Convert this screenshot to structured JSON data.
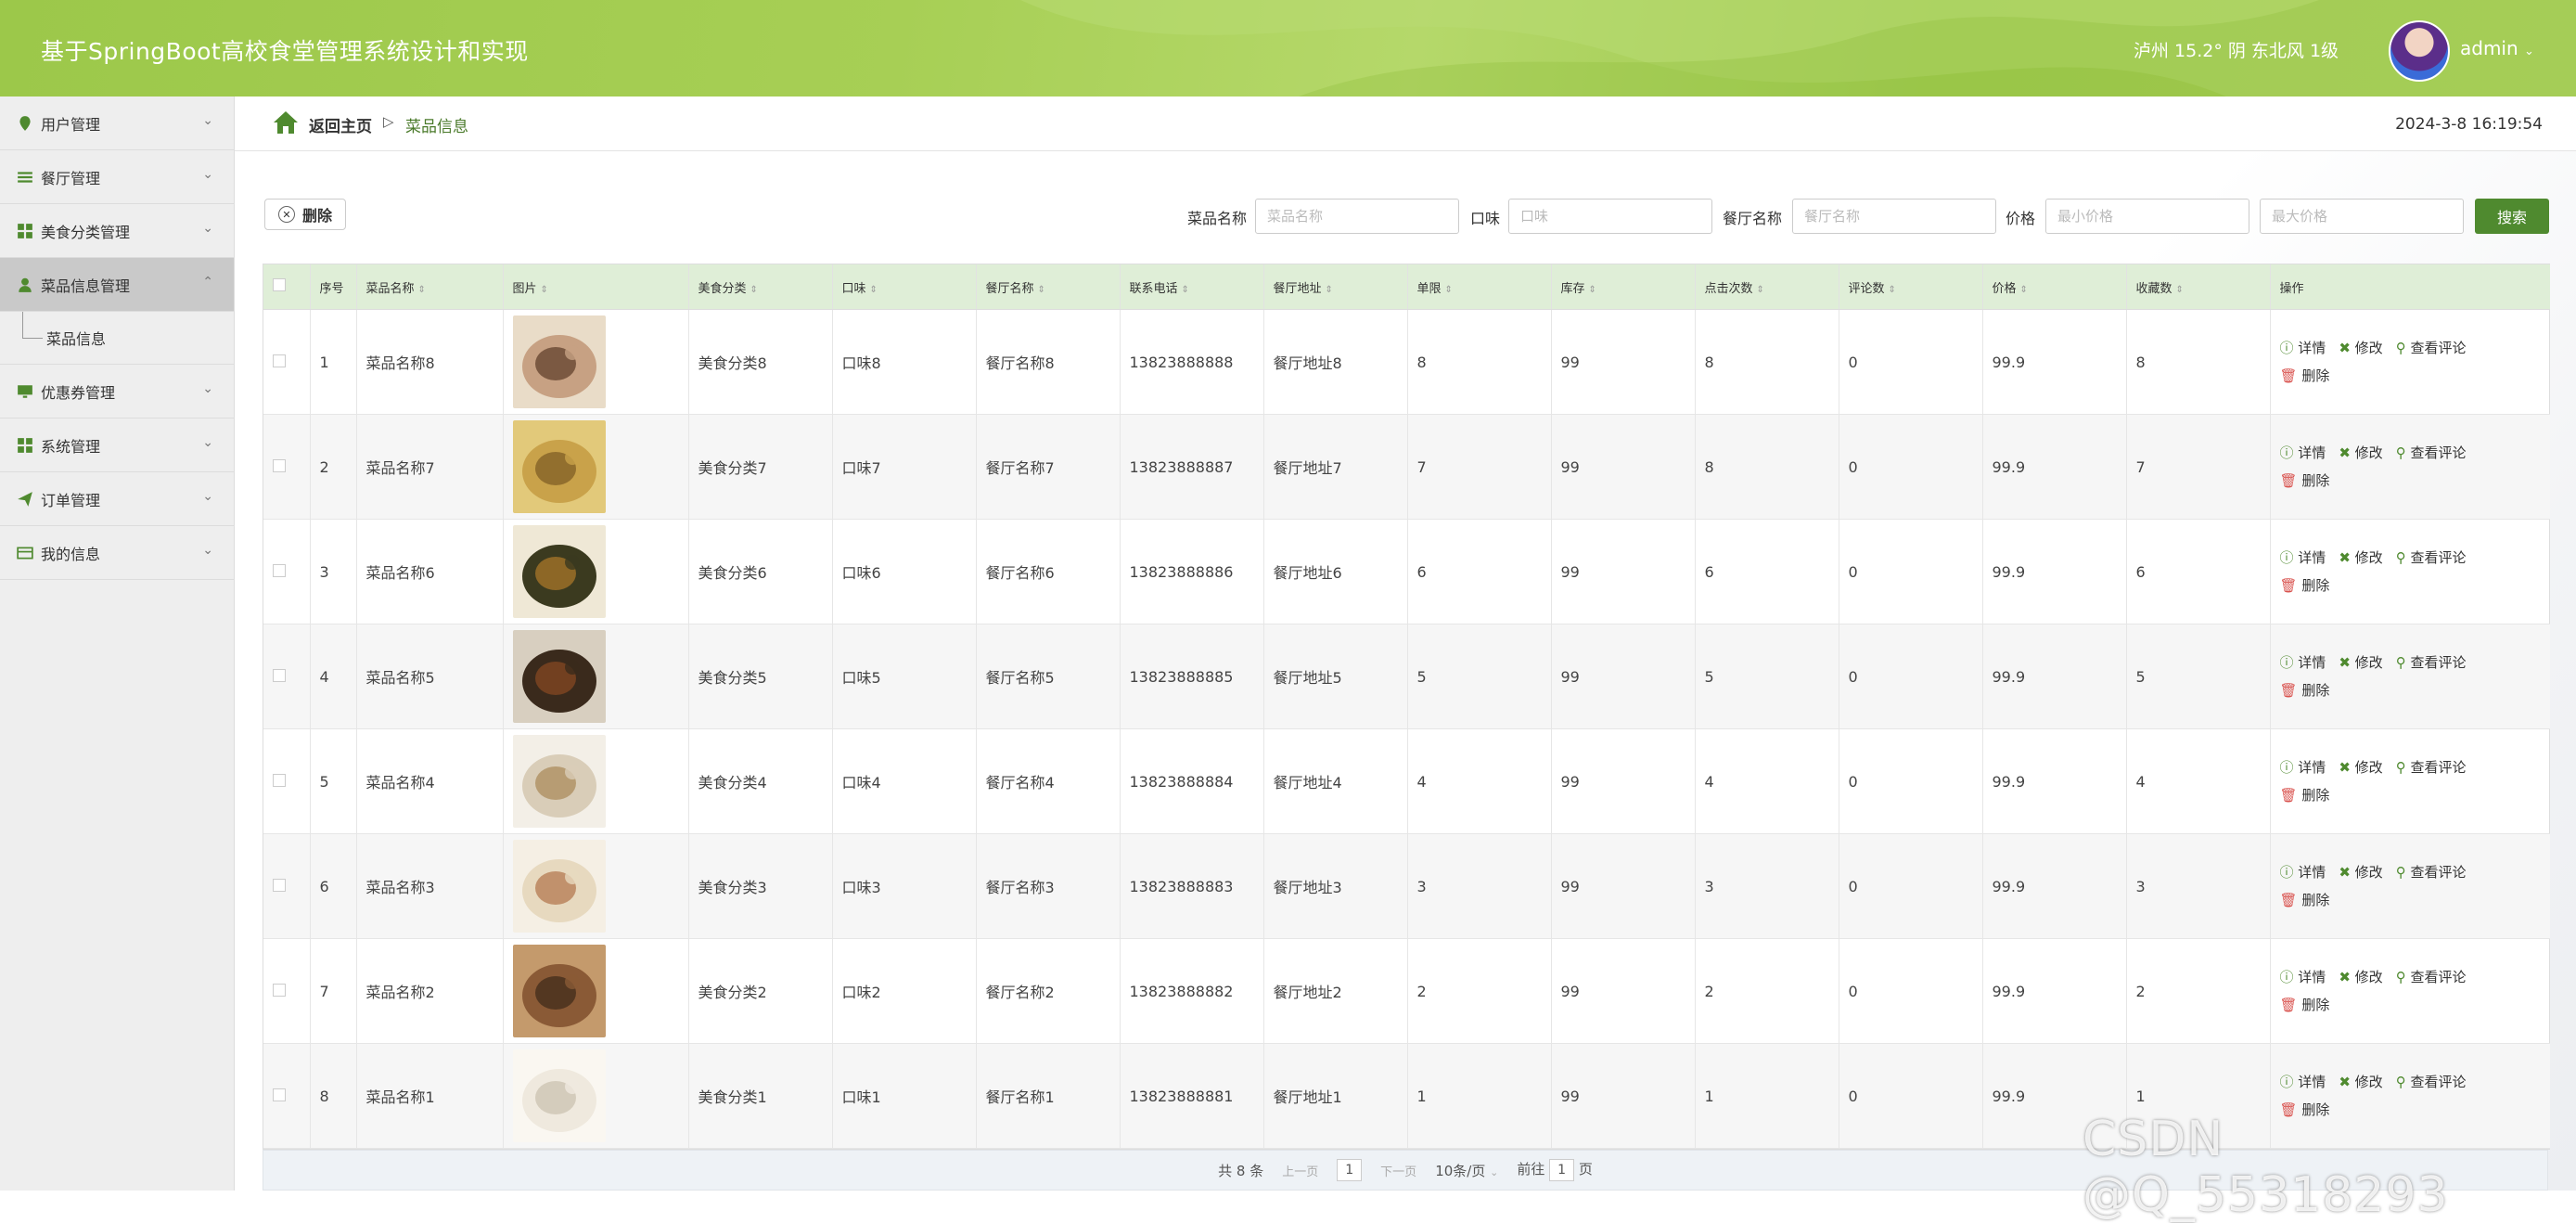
{
  "header": {
    "title": "基于SpringBoot高校食堂管理系统设计和实现",
    "weather": "泸州 15.2° 阴 东北风 1级",
    "username": "admin"
  },
  "sidebar": {
    "items": [
      {
        "label": "用户管理",
        "icon": "location-pin-icon"
      },
      {
        "label": "餐厅管理",
        "icon": "list-icon"
      },
      {
        "label": "美食分类管理",
        "icon": "grid-icon"
      },
      {
        "label": "菜品信息管理",
        "icon": "user-icon",
        "active": true
      },
      {
        "label": "优惠券管理",
        "icon": "monitor-icon"
      },
      {
        "label": "系统管理",
        "icon": "grid-icon"
      },
      {
        "label": "订单管理",
        "icon": "send-icon"
      },
      {
        "label": "我的信息",
        "icon": "card-icon"
      }
    ],
    "sub_item": "菜品信息"
  },
  "breadcrumb": {
    "home": "返回主页",
    "separator": "▷",
    "current": "菜品信息"
  },
  "datetime": "2024-3-8 16:19:54",
  "toolbar": {
    "delete_label": "删除"
  },
  "search": {
    "name_label": "菜品名称",
    "name_placeholder": "菜品名称",
    "taste_label": "口味",
    "taste_placeholder": "口味",
    "restaurant_label": "餐厅名称",
    "restaurant_placeholder": "餐厅名称",
    "price_label": "价格",
    "min_price_placeholder": "最小价格",
    "max_price_placeholder": "最大价格",
    "search_button": "搜索"
  },
  "table": {
    "headers": [
      "序号",
      "菜品名称",
      "图片",
      "美食分类",
      "口味",
      "餐厅名称",
      "联系电话",
      "餐厅地址",
      "单限",
      "库存",
      "点击次数",
      "评论数",
      "价格",
      "收藏数",
      "操作"
    ],
    "ops": {
      "detail": "详情",
      "edit": "修改",
      "comments": "查看评论",
      "delete": "删除"
    },
    "rows": [
      {
        "no": "1",
        "name": "菜品名称8",
        "category": "美食分类8",
        "taste": "口味8",
        "restaurant": "餐厅名称8",
        "phone": "13823888888",
        "address": "餐厅地址8",
        "limit": "8",
        "stock": "99",
        "clicks": "8",
        "comments": "0",
        "price": "99.9",
        "favorites": "8",
        "image": "drink-and-cake"
      },
      {
        "no": "2",
        "name": "菜品名称7",
        "category": "美食分类7",
        "taste": "口味7",
        "restaurant": "餐厅名称7",
        "phone": "13823888887",
        "address": "餐厅地址7",
        "limit": "7",
        "stock": "99",
        "clicks": "8",
        "comments": "0",
        "price": "99.9",
        "favorites": "7",
        "image": "egg-rolls"
      },
      {
        "no": "3",
        "name": "菜品名称6",
        "category": "美食分类6",
        "taste": "口味6",
        "restaurant": "餐厅名称6",
        "phone": "13823888886",
        "address": "餐厅地址6",
        "limit": "6",
        "stock": "99",
        "clicks": "6",
        "comments": "0",
        "price": "99.9",
        "favorites": "6",
        "image": "stir-fry-plate"
      },
      {
        "no": "4",
        "name": "菜品名称5",
        "category": "美食分类5",
        "taste": "口味5",
        "restaurant": "餐厅名称5",
        "phone": "13823888885",
        "address": "餐厅地址5",
        "limit": "5",
        "stock": "99",
        "clicks": "5",
        "comments": "0",
        "price": "99.9",
        "favorites": "5",
        "image": "spicy-dish"
      },
      {
        "no": "5",
        "name": "菜品名称4",
        "category": "美食分类4",
        "taste": "口味4",
        "restaurant": "餐厅名称4",
        "phone": "13823888884",
        "address": "餐厅地址4",
        "limit": "4",
        "stock": "99",
        "clicks": "4",
        "comments": "0",
        "price": "99.9",
        "favorites": "4",
        "image": "pastry-plate"
      },
      {
        "no": "6",
        "name": "菜品名称3",
        "category": "美食分类3",
        "taste": "口味3",
        "restaurant": "餐厅名称3",
        "phone": "13823888883",
        "address": "餐厅地址3",
        "limit": "3",
        "stock": "99",
        "clicks": "3",
        "comments": "0",
        "price": "99.9",
        "favorites": "3",
        "image": "milk-tea"
      },
      {
        "no": "7",
        "name": "菜品名称2",
        "category": "美食分类2",
        "taste": "口味2",
        "restaurant": "餐厅名称2",
        "phone": "13823888882",
        "address": "餐厅地址2",
        "limit": "2",
        "stock": "99",
        "clicks": "2",
        "comments": "0",
        "price": "99.9",
        "favorites": "2",
        "image": "skewers"
      },
      {
        "no": "8",
        "name": "菜品名称1",
        "category": "美食分类1",
        "taste": "口味1",
        "restaurant": "餐厅名称1",
        "phone": "13823888881",
        "address": "餐厅地址1",
        "limit": "1",
        "stock": "99",
        "clicks": "1",
        "comments": "0",
        "price": "99.9",
        "favorites": "1",
        "image": "dumplings"
      }
    ]
  },
  "pagination": {
    "total": "共 8 条",
    "prev": "上一页",
    "page": "1",
    "next": "下一页",
    "page_size": "10条/页",
    "goto_label": "前往",
    "goto_value": "1",
    "page_suffix": "页"
  },
  "watermark": "CSDN @Q_55318293",
  "colors": {
    "accent": "#4f8a2f",
    "header_bg": "#a5cd52",
    "table_header_bg": "#dfeed7",
    "delete_red": "#d9534f"
  }
}
